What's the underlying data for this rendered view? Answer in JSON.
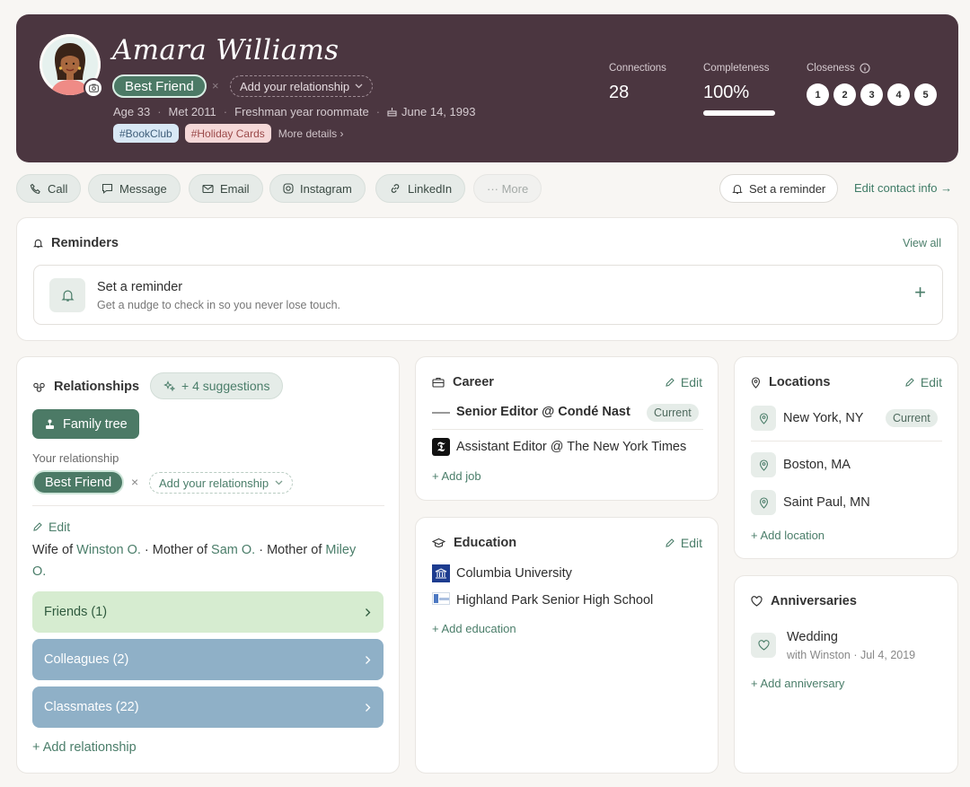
{
  "profile": {
    "name": "Amara Williams",
    "relationship_badge": "Best Friend",
    "remove_glyph": "×",
    "add_relationship": "Add your relationship",
    "age": "Age 33",
    "met": "Met 2011",
    "context": "Freshman year roommate",
    "birthday": "June 14, 1993",
    "tags": [
      "#BookClub",
      "#Holiday Cards"
    ],
    "more_details": "More details"
  },
  "stats": {
    "connections_label": "Connections",
    "connections_value": "28",
    "completeness_label": "Completeness",
    "completeness_value": "100%",
    "completeness_fraction": 1.0,
    "closeness_label": "Closeness",
    "closeness_levels": [
      "1",
      "2",
      "3",
      "4",
      "5"
    ]
  },
  "actions": {
    "call": "Call",
    "message": "Message",
    "email": "Email",
    "instagram": "Instagram",
    "linkedin": "LinkedIn",
    "more": "··· More",
    "set_reminder": "Set a reminder",
    "edit_contact": "Edit contact info →"
  },
  "reminders": {
    "title": "Reminders",
    "view_all": "View all",
    "item_title": "Set a reminder",
    "item_desc": "Get a nudge to check in so you never lose touch.",
    "add_glyph": "+"
  },
  "relationships": {
    "title": "Relationships",
    "suggestions": "+ 4 suggestions",
    "family_tree": "Family tree",
    "your_relationship_label": "Your relationship",
    "relationship_badge": "Best Friend",
    "remove_glyph": "×",
    "add_relationship": "Add your relationship",
    "edit": "Edit",
    "wife_of": "Wife of",
    "winston": "Winston O.",
    "mother_of_1": "· Mother of",
    "sam": "Sam O.",
    "mother_of_2": "· Mother of",
    "miley_1": "Miley",
    "miley_2": "O.",
    "groups": [
      {
        "label": "Friends (1)",
        "color": "#d6ecd0"
      },
      {
        "label": "Colleagues (2)",
        "color": "#8fb0c7"
      },
      {
        "label": "Classmates (22)",
        "color": "#8fb0c7"
      }
    ],
    "add": "+ Add relationship"
  },
  "career": {
    "title": "Career",
    "edit": "Edit",
    "jobs": [
      {
        "title": "Senior Editor @ Condé Nast",
        "badge": "Current",
        "logo": "conde-nast-logo"
      },
      {
        "title": "Assistant Editor @ The New York Times",
        "logo": "nyt-logo"
      }
    ],
    "nyt_glyph": "𝕿",
    "add": "+ Add job"
  },
  "education": {
    "title": "Education",
    "edit": "Edit",
    "schools": [
      {
        "name": "Columbia University",
        "logo": "columbia-logo"
      },
      {
        "name": "Highland Park Senior High School",
        "logo": "highland-park-logo"
      }
    ],
    "add": "+ Add education"
  },
  "locations": {
    "title": "Locations",
    "edit": "Edit",
    "items": [
      {
        "name": "New York, NY",
        "badge": "Current"
      },
      {
        "name": "Boston, MA"
      },
      {
        "name": "Saint Paul, MN"
      }
    ],
    "add": "+ Add location"
  },
  "anniversaries": {
    "title": "Anniversaries",
    "item_title": "Wedding",
    "item_with": "with Winston",
    "item_date": "Jul 4, 2019",
    "add": "+ Add anniversary"
  },
  "colors": {
    "header_bg": "#4b3640",
    "accent_green": "#4c7a66",
    "link_green": "#4b7e6a",
    "friends_green": "#d6ecd0",
    "group_blue": "#8fb0c7"
  }
}
